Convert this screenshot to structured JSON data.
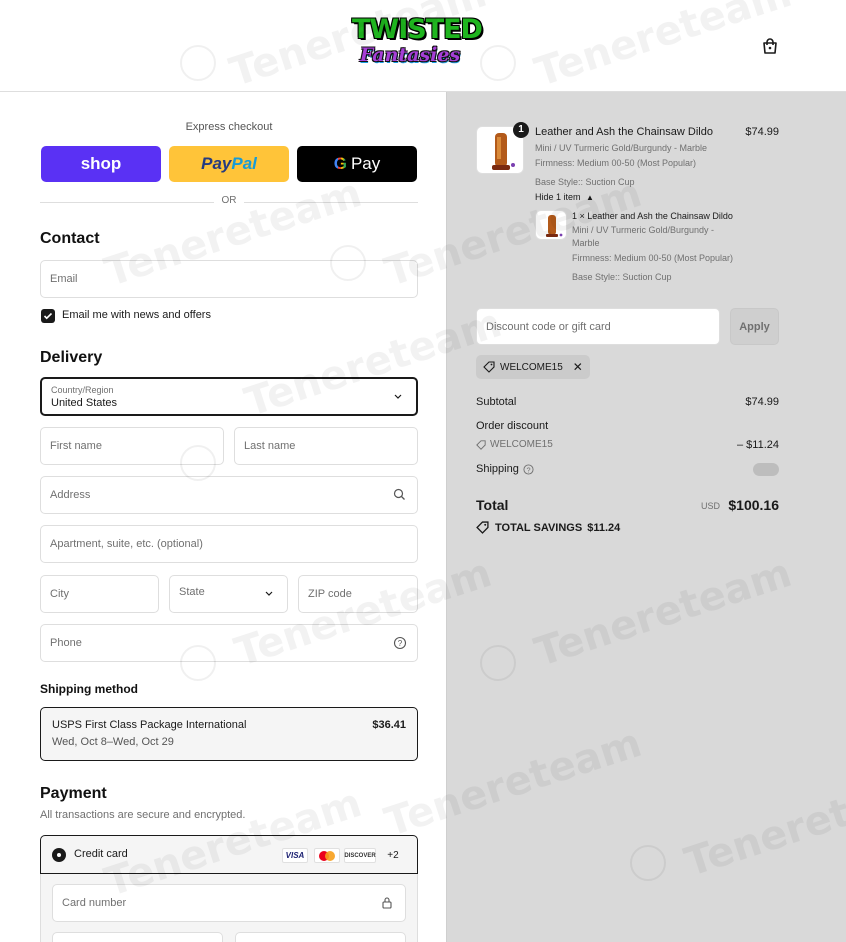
{
  "header": {
    "logo_top": "TWISTED",
    "logo_bottom": "Fantasies",
    "bag_icon": "shopping-bag-icon"
  },
  "express": {
    "title": "Express checkout",
    "shop_label": "shop",
    "paypal_label_1": "Pay",
    "paypal_label_2": "Pal",
    "gpay_g": "G",
    "gpay_label": "Pay",
    "or_label": "OR"
  },
  "contact": {
    "heading": "Contact",
    "email_placeholder": "Email",
    "newsletter_label": "Email me with news and offers",
    "newsletter_checked": true
  },
  "delivery": {
    "heading": "Delivery",
    "country_label": "Country/Region",
    "country_value": "United States",
    "first_name": "First name",
    "last_name": "Last name",
    "address": "Address",
    "apartment": "Apartment, suite, etc. (optional)",
    "city": "City",
    "state": "State",
    "zip": "ZIP code",
    "phone": "Phone"
  },
  "shipping": {
    "heading": "Shipping method",
    "option_name": "USPS First Class Package International",
    "option_dates": "Wed, Oct 8–Wed, Oct 29",
    "option_price": "$36.41"
  },
  "payment": {
    "heading": "Payment",
    "subtitle": "All transactions are secure and encrypted.",
    "method_label": "Credit card",
    "cards": [
      "VISA",
      "",
      "DISCOVER"
    ],
    "more_cards": "+2",
    "card_number_placeholder": "Card number"
  },
  "summary": {
    "product": {
      "quantity": "1",
      "name": "Leather and Ash the Chainsaw Dildo",
      "variant": "Mini / UV Turmeric Gold/Burgundy - Marble",
      "firmness": "Firmness: Medium 00-50 (Most Popular)",
      "base": "Base Style:: Suction Cup",
      "price": "$74.99",
      "hide_label": "Hide 1 item",
      "bundle_name": "1 × Leather and Ash the Chainsaw Dildo",
      "bundle_variant": "Mini / UV Turmeric Gold/Burgundy - Marble",
      "bundle_firmness": "Firmness: Medium 00-50 (Most Popular)",
      "bundle_base": "Base Style:: Suction Cup"
    },
    "discount_placeholder": "Discount code or gift card",
    "apply_label": "Apply",
    "applied_code": "WELCOME15",
    "subtotal_label": "Subtotal",
    "subtotal_value": "$74.99",
    "order_discount_label": "Order discount",
    "order_discount_code": "WELCOME15",
    "order_discount_value": "– $11.24",
    "shipping_label": "Shipping",
    "total_label": "Total",
    "currency": "USD",
    "total_value": "$100.16",
    "savings_label": "TOTAL SAVINGS",
    "savings_value": "$11.24"
  },
  "watermark": "Tenereteam",
  "colors": {
    "shop": "#5a31f4",
    "paypal": "#ffc439",
    "gpay": "#000000",
    "summary_bg": "#d9d9d9"
  }
}
